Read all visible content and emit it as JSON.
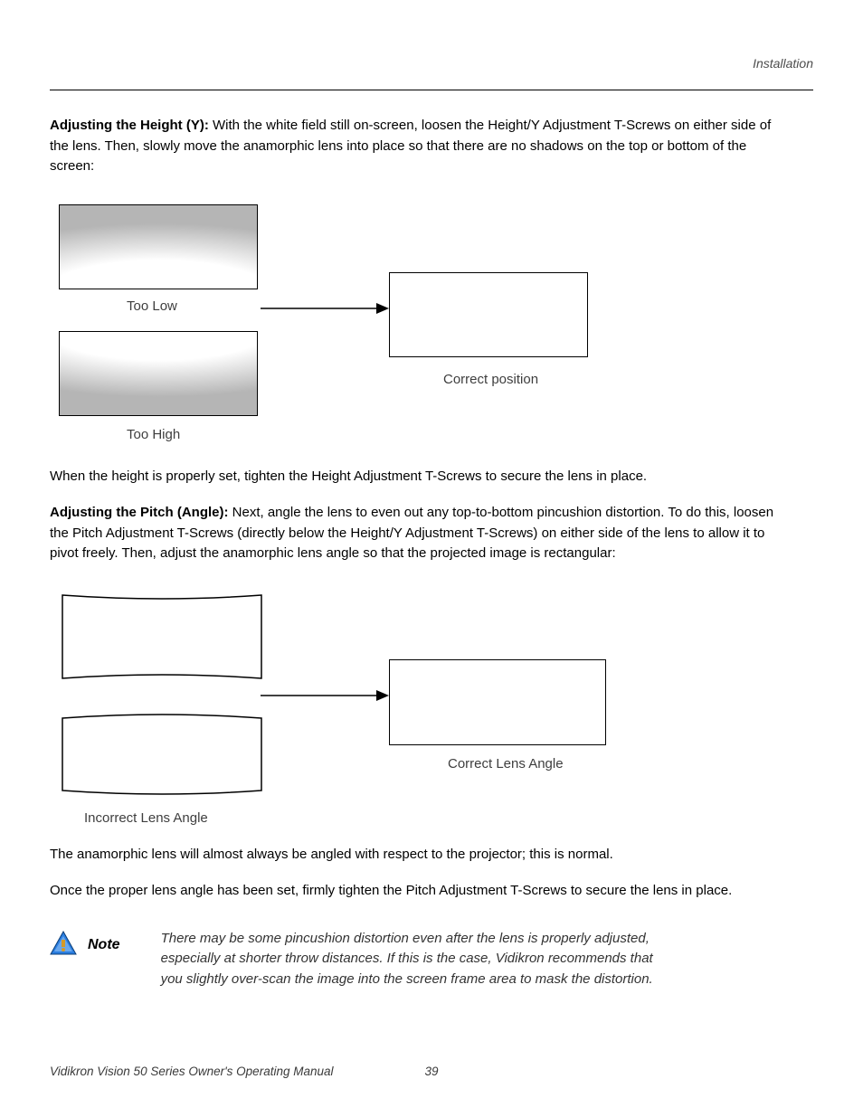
{
  "header": {
    "section": "Installation"
  },
  "section1": {
    "heading": "Adjusting the Height (Y):",
    "text": " With the white field still on-screen, loosen the Height/Y Adjustment T-Screws on either side of the lens. Then, slowly move the anamorphic lens into place so that there are no shadows on the top or bottom of the screen:"
  },
  "diagram1": {
    "too_low": "Too Low",
    "too_high": "Too High",
    "correct": "Correct position"
  },
  "after1": "When the height is properly set, tighten the Height Adjustment T-Screws to secure the lens in place.",
  "section2": {
    "heading": "Adjusting the Pitch (Angle):",
    "text": " Next, angle the lens to even out any top-to-bottom pincushion distortion. To do this, loosen the Pitch Adjustment T-Screws (directly below the Height/Y Adjustment T-Screws) on either side of the lens to allow it to pivot freely. Then, adjust the anamorphic lens angle so that the projected image is rectangular:"
  },
  "diagram2": {
    "incorrect": "Incorrect Lens Angle",
    "correct": "Correct Lens Angle"
  },
  "after2a": "The anamorphic lens will almost always be angled with respect to the projector; this is normal.",
  "after2b": "Once the proper lens angle has been set, firmly tighten the Pitch Adjustment T-Screws to secure the lens in place.",
  "note": {
    "label": "Note",
    "text": "There may be some pincushion distortion even after the lens is properly adjusted, especially at shorter throw distances. If this is the case, Vidikron recommends that you slightly over-scan the image into the screen frame area to mask the distortion."
  },
  "footer": {
    "manual": "Vidikron Vision 50 Series Owner's Operating Manual",
    "page": "39"
  }
}
